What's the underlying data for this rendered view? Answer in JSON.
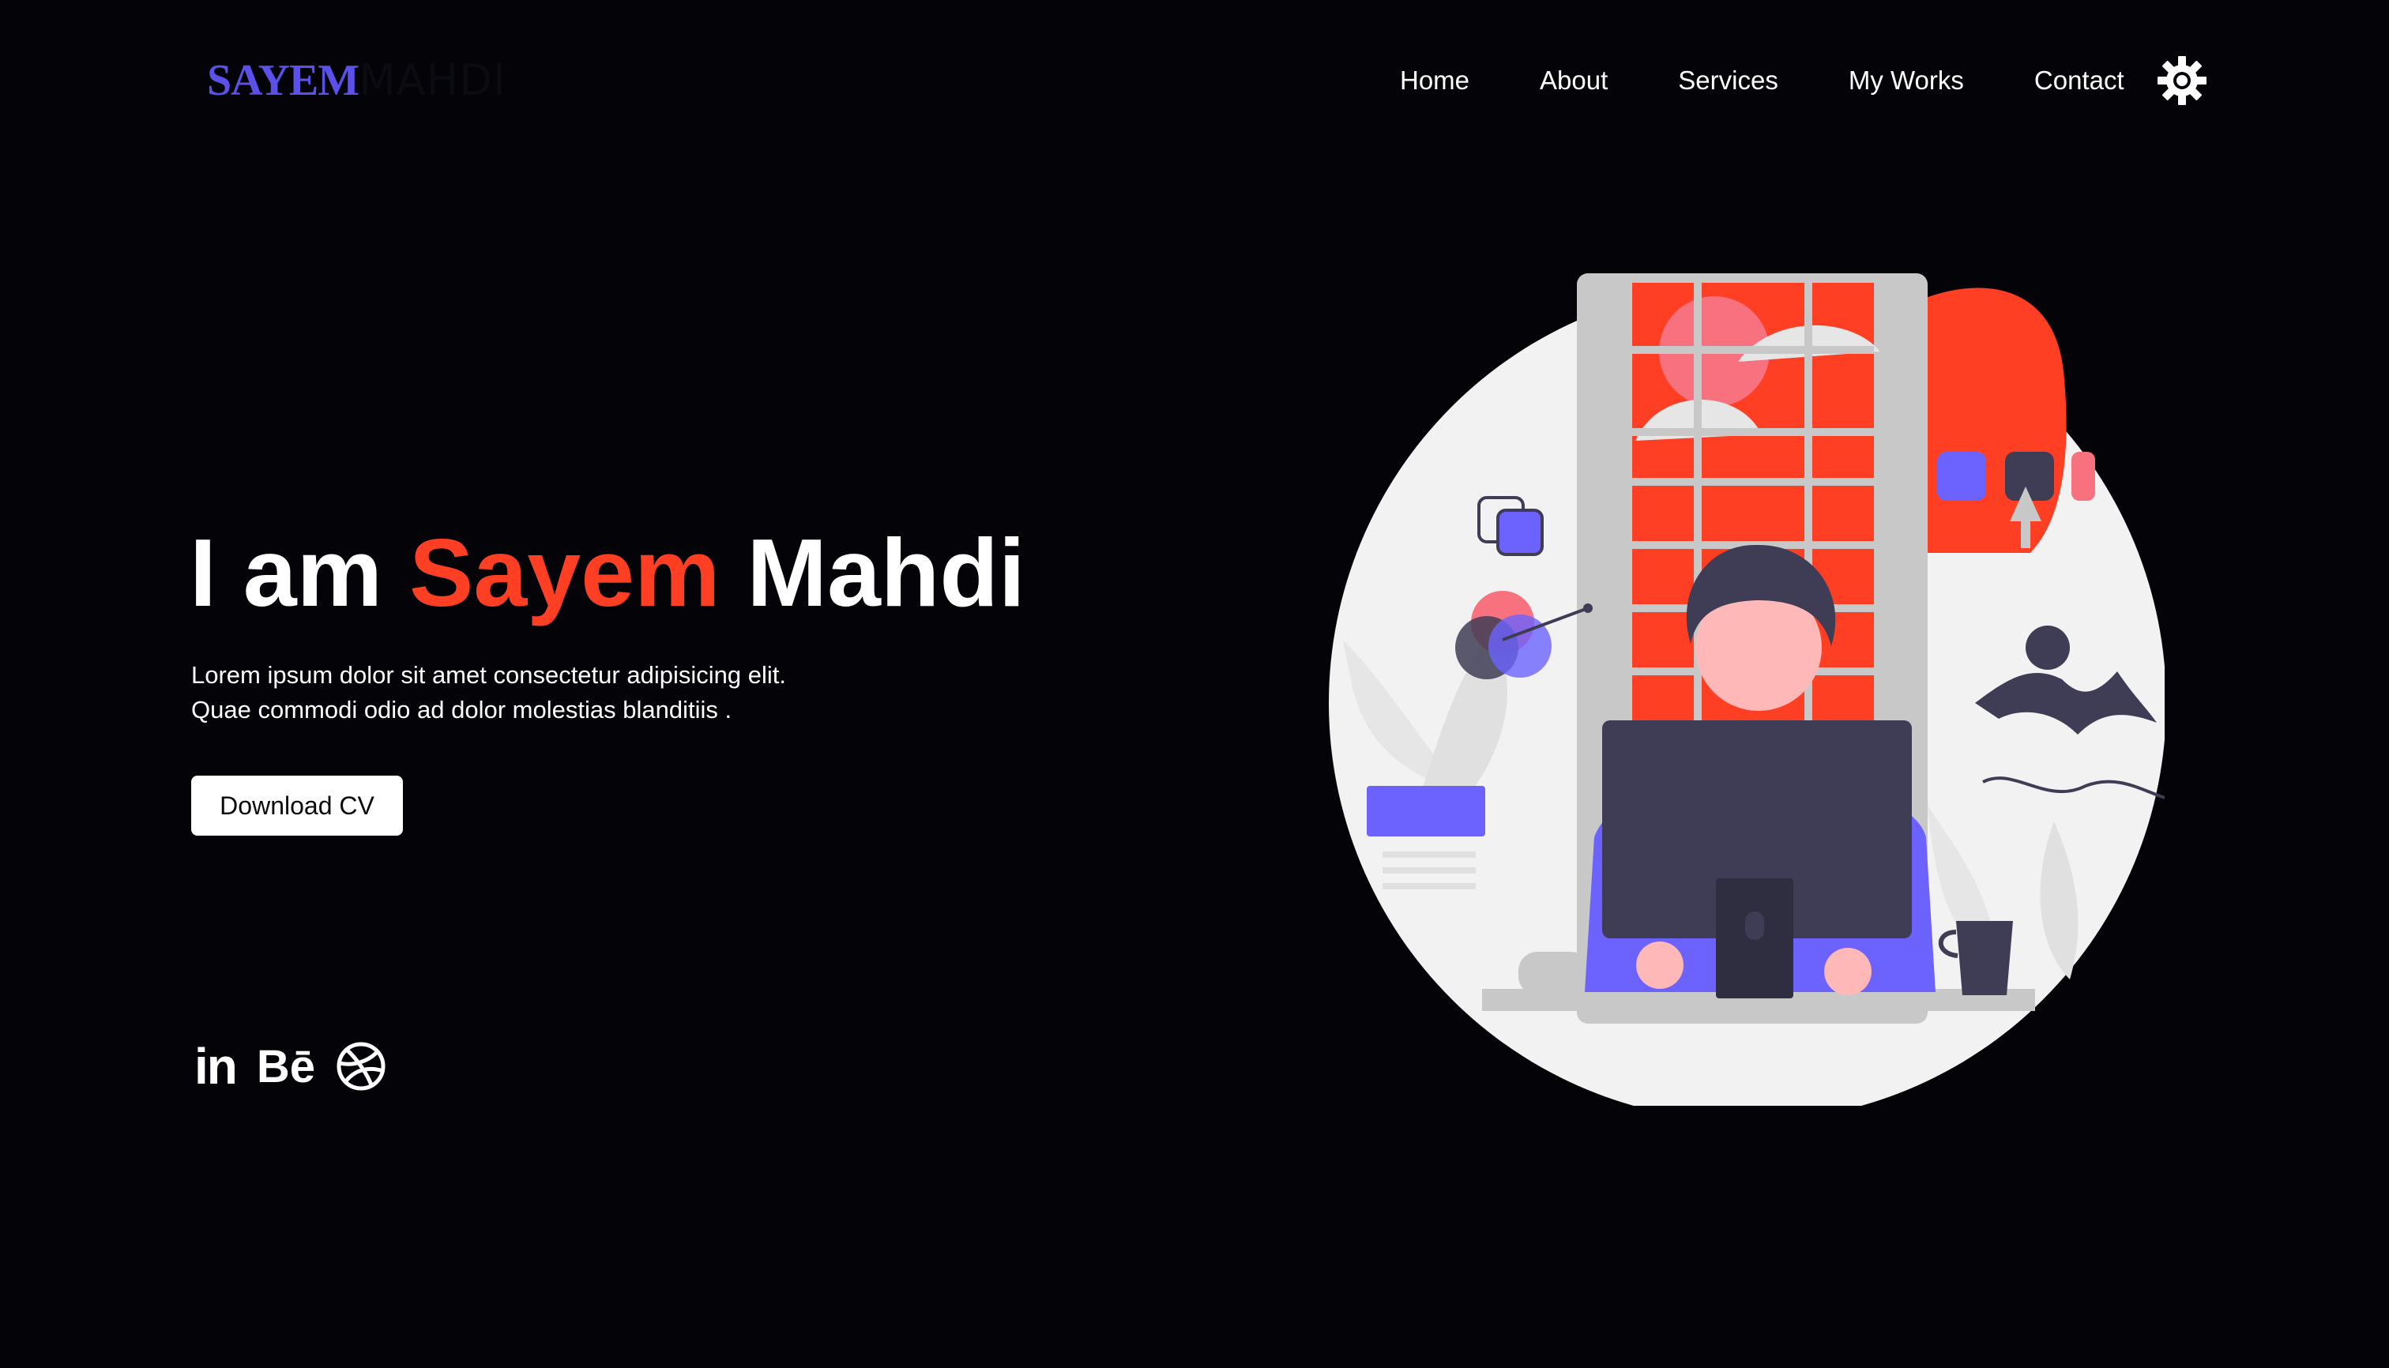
{
  "brand": {
    "first": "SAYEM",
    "last": "MAHDI"
  },
  "nav": {
    "items": [
      "Home",
      "About",
      "Services",
      "My Works",
      "Contact"
    ]
  },
  "theme_toggle": {
    "icon": "sun-icon"
  },
  "hero": {
    "title_prefix": "I am ",
    "title_accent": "Sayem",
    "title_suffix": " Mahdi",
    "description_line1": "Lorem ipsum dolor sit amet consectetur adipisicing elit.",
    "description_line2": "Quae commodi odio ad dolor molestias blanditiis .",
    "cta_label": "Download CV"
  },
  "socials": {
    "linkedin": "in",
    "behance": "Bē",
    "dribbble_icon": "dribbble-icon"
  },
  "colors": {
    "background": "#040308",
    "accent_orange": "#ff3f24",
    "brand_purple": "#5b50e8",
    "text": "#ffffff",
    "illustration_pink": "#f7717f",
    "illustration_dark": "#3f3d56",
    "illustration_purple": "#6c63ff",
    "illustration_light": "#f2f2f2",
    "illustration_gray": "#c8c8c8",
    "skin": "#ffb8b8"
  }
}
